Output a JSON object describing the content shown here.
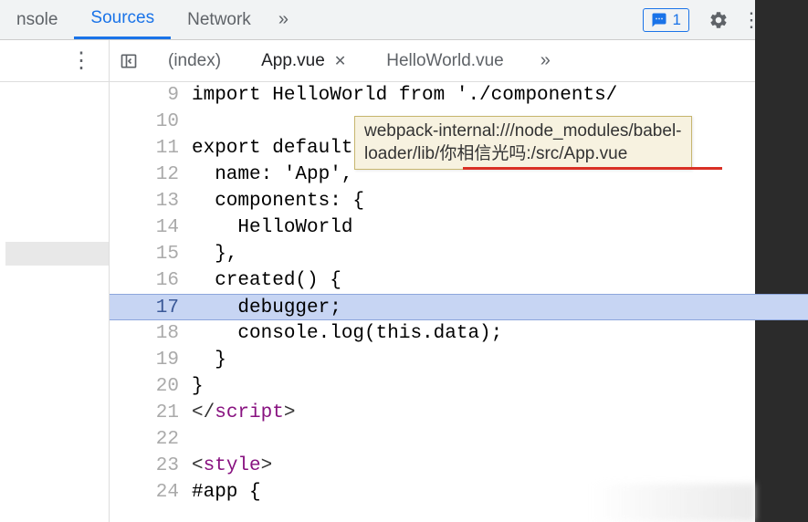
{
  "mainTabs": {
    "console": "nsole",
    "sources": "Sources",
    "network": "Network"
  },
  "issueCount": "1",
  "fileTabs": {
    "index": "(index)",
    "app": "App.vue",
    "hello": "HelloWorld.vue"
  },
  "tooltip": {
    "line1": "webpack-internal:///node_modules/babel-",
    "line2": "loader/lib/你相信光吗:/src/App.vue"
  },
  "code": {
    "l9": "import HelloWorld from './components/",
    "l10": "",
    "l11a": "export default",
    "l11b": " {",
    "l12": "  name: 'App',",
    "l13": "  components: {",
    "l14": "    HelloWorld",
    "l15": "  },",
    "l16": "  created() {",
    "l17": "    debugger;",
    "l18": "    console.log(this.data);",
    "l19": "  }",
    "l20": "}",
    "l21a": "</",
    "l21b": "script",
    "l21c": ">",
    "l22": "",
    "l23a": "<",
    "l23b": "style",
    "l23c": ">",
    "l24": "#app {"
  },
  "gutters": {
    "g9": "9",
    "g10": "10",
    "g11": "11",
    "g12": "12",
    "g13": "13",
    "g14": "14",
    "g15": "15",
    "g16": "16",
    "g17": "17",
    "g18": "18",
    "g19": "19",
    "g20": "20",
    "g21": "21",
    "g22": "22",
    "g23": "23",
    "g24": "24"
  }
}
